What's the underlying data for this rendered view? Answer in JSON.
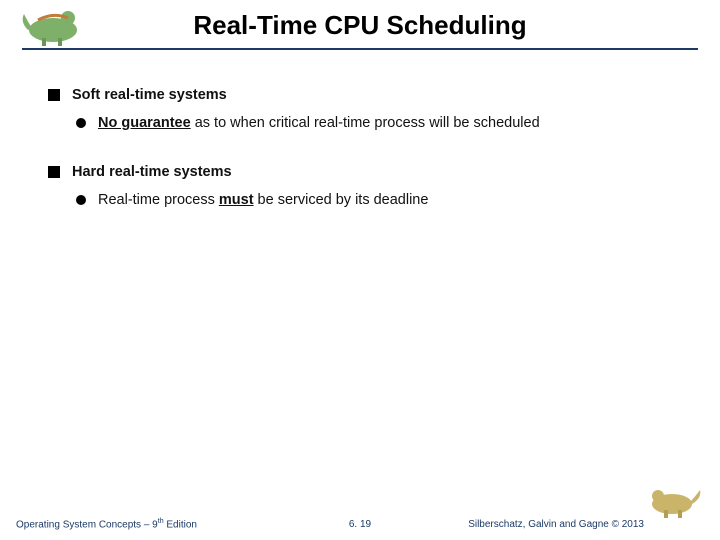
{
  "title": "Real-Time CPU Scheduling",
  "bullets": {
    "soft_heading": "Soft real-time systems",
    "soft_sub_prefix": "No guarantee",
    "soft_sub_rest": " as to when critical real-time process will be scheduled",
    "hard_heading": "Hard real-time systems",
    "hard_sub_prefix": "Real-time process ",
    "hard_sub_mid": "must",
    "hard_sub_rest": " be serviced by its deadline"
  },
  "footer": {
    "left_a": "Operating System Concepts – 9",
    "left_sup": "th",
    "left_b": " Edition",
    "center": "6. 19",
    "right": "Silberschatz, Galvin and Gagne © 2013"
  }
}
